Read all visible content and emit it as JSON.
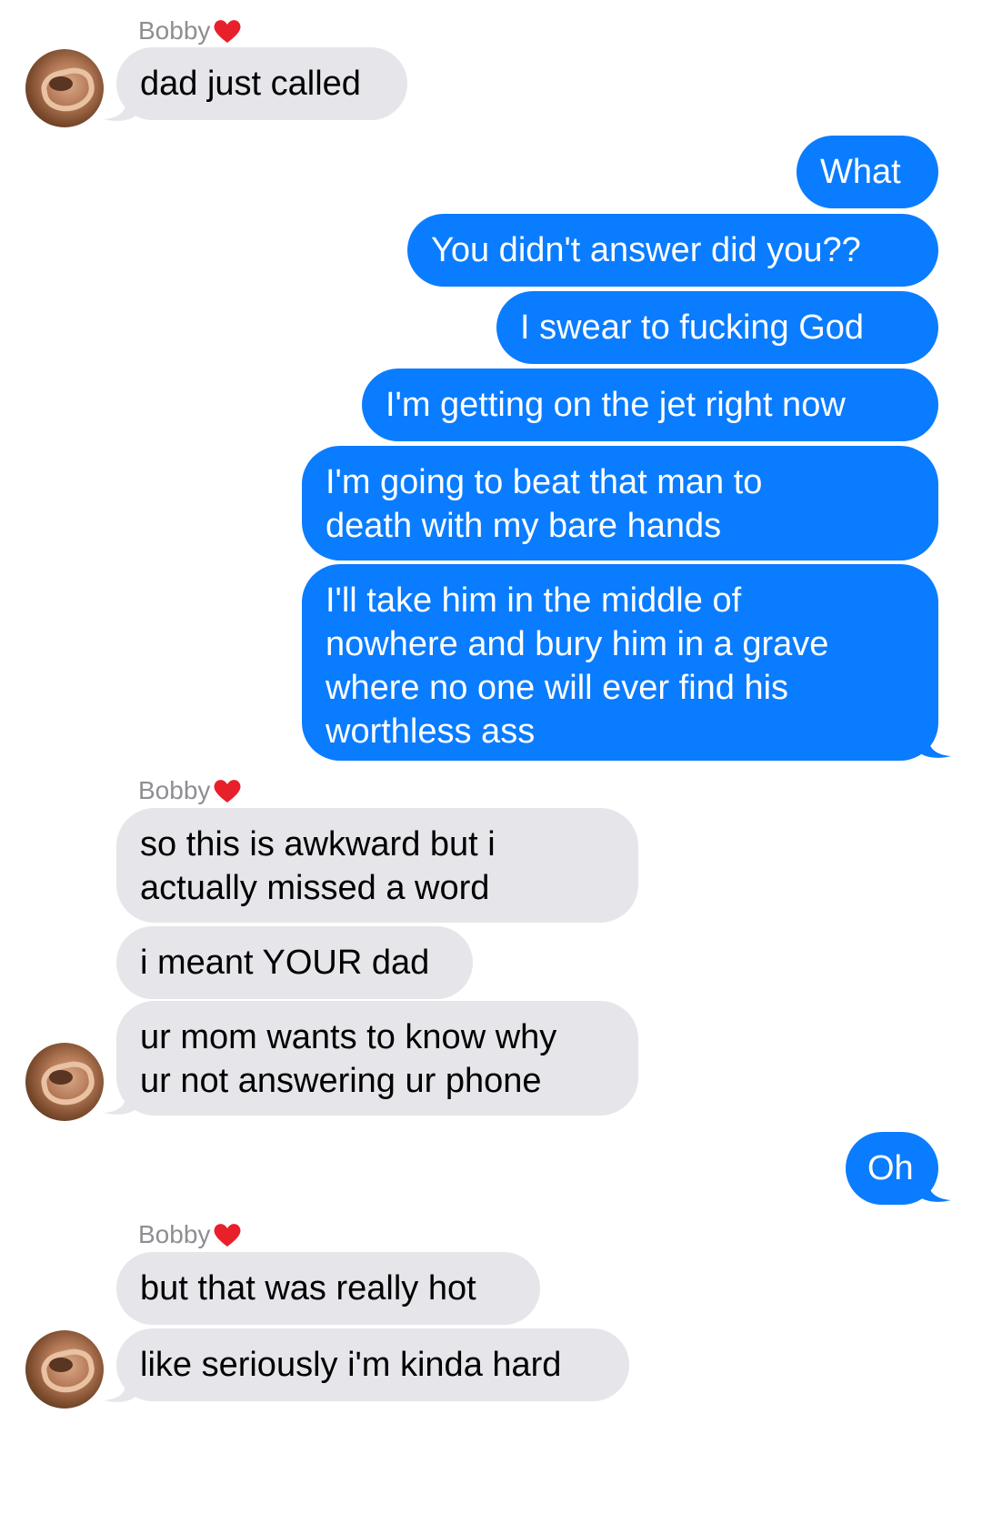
{
  "contact": {
    "name": "Bobby",
    "heart": "red-heart-emoji"
  },
  "colors": {
    "incoming_bg": "#e5e5ea",
    "outgoing_bg": "#0a7cff",
    "name_gray": "#8e8e93"
  },
  "messages": [
    {
      "from": "them",
      "text": "dad just called"
    },
    {
      "from": "me",
      "text": "What"
    },
    {
      "from": "me",
      "text": "You didn't answer did you??"
    },
    {
      "from": "me",
      "text": "I swear to fucking God"
    },
    {
      "from": "me",
      "text": "I'm getting on the jet right now"
    },
    {
      "from": "me",
      "text": "I'm going to beat that man to\ndeath with my bare hands"
    },
    {
      "from": "me",
      "text": "I'll take him in the middle of\nnowhere and bury him in a grave\nwhere no one will ever find his\nworthless ass"
    },
    {
      "from": "them",
      "text": "so this is awkward but i\nactually missed a word"
    },
    {
      "from": "them",
      "text": "i meant YOUR dad"
    },
    {
      "from": "them",
      "text": "ur mom wants to know why\nur not answering ur phone"
    },
    {
      "from": "me",
      "text": "Oh"
    },
    {
      "from": "them",
      "text": "but that was really hot"
    },
    {
      "from": "them",
      "text": "like seriously i'm kinda hard"
    }
  ]
}
